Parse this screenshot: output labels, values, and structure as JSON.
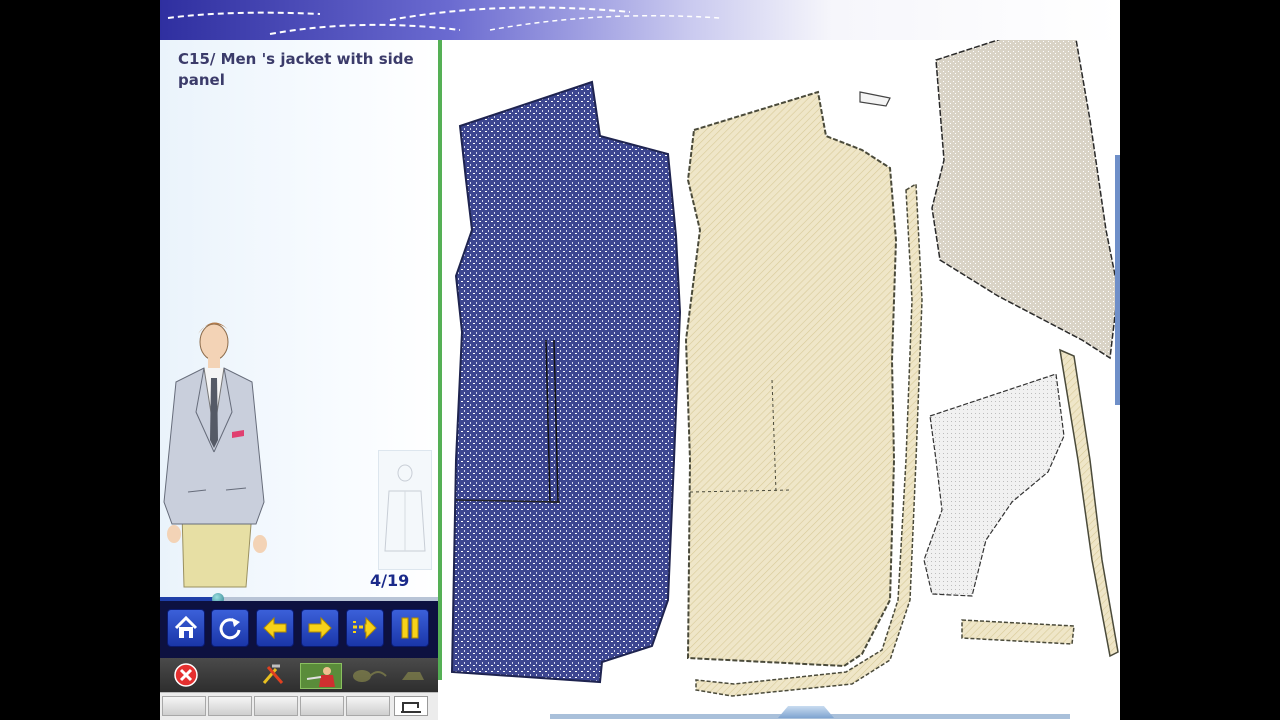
{
  "lesson": {
    "title": "C15/ Men 's jacket with side panel",
    "counter": "4/19",
    "progress_fraction": 0.21
  },
  "toolbar": {
    "buttons": [
      {
        "name": "home-button",
        "icon": "home-icon"
      },
      {
        "name": "replay-button",
        "icon": "refresh-icon"
      },
      {
        "name": "previous-button",
        "icon": "arrow-left-icon"
      },
      {
        "name": "next-button",
        "icon": "arrow-right-icon"
      },
      {
        "name": "skip-button",
        "icon": "dashed-arrow-right-icon"
      },
      {
        "name": "pause-button",
        "icon": "pause-icon"
      }
    ]
  },
  "tools": {
    "items": [
      "close-icon",
      "tools-icon",
      "tailor-icon",
      "thread-icon",
      "iron-icon"
    ]
  },
  "colors": {
    "banner": "#2f2fa0",
    "divider": "#55b055",
    "nav_background": "#0d1140",
    "button_blue": "#2846c2",
    "fabric_navy": "#3d4690",
    "lining_tan": "#e9dfbf",
    "interfacing_grey": "#d9d3c6"
  }
}
